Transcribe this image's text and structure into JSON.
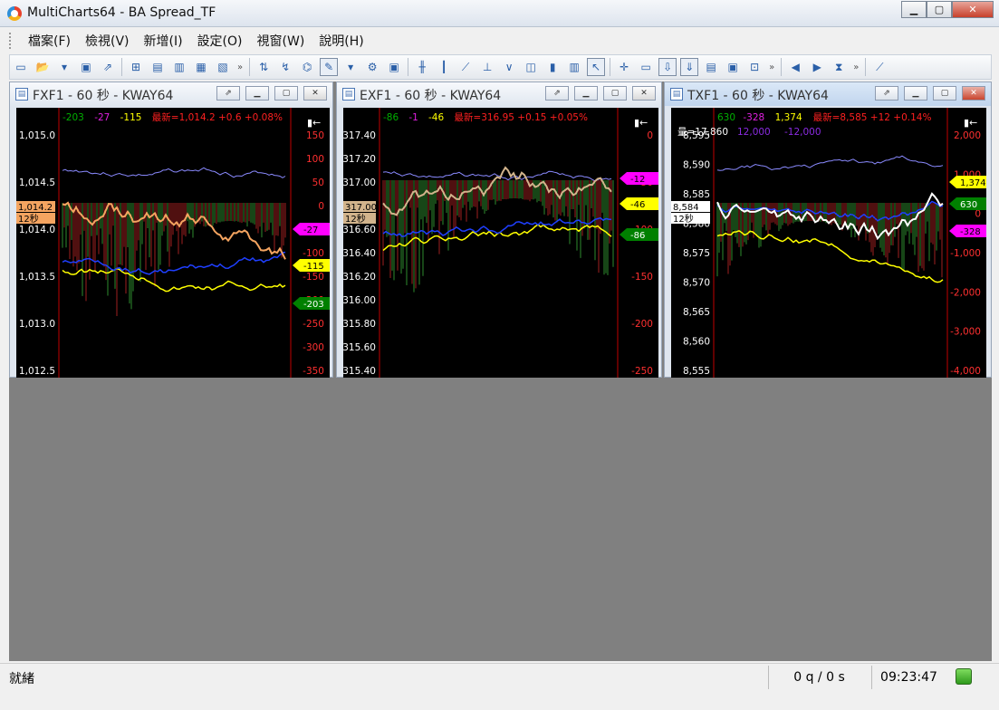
{
  "window": {
    "title": "MultiCharts64 - BA Spread_TF"
  },
  "menu": [
    "檔案(F)",
    "檢視(V)",
    "新增(I)",
    "設定(O)",
    "視窗(W)",
    "說明(H)"
  ],
  "toolbar": {
    "icons": [
      "new-chart-icon",
      "open-icon",
      "dropdown-icon",
      "save-icon",
      "export-icon",
      "new-window-icon",
      "insert-study-icon",
      "format-icon",
      "quote-icon",
      "scanner-icon",
      "more-icon",
      "indicator-icon",
      "signal-icon",
      "strategy-icon",
      "draw-tool-icon",
      "dropdown-icon",
      "autotrade-icon",
      "data-window-icon",
      "bar-chart-icon",
      "candle-chart-icon",
      "line-chart-icon",
      "hlc-chart-icon",
      "point-figure-icon",
      "hollow-candle-icon",
      "volume-candle-icon",
      "rainbow-icon",
      "cursor-icon",
      "crosshair-icon",
      "drawing-icon",
      "trade-bar-icon",
      "trade-down-icon",
      "view-icon",
      "screenshot-icon",
      "zoom-icon",
      "more-icon",
      "rewind-icon",
      "forward-icon",
      "hourglass-icon",
      "more-icon",
      "trendline-icon"
    ]
  },
  "charts": [
    {
      "title": "FXF1 - 60 秒 - KWAY64",
      "legend": [
        {
          "text": "-203",
          "color": "#00b000"
        },
        {
          "text": "-27",
          "color": "#e020e0"
        },
        {
          "text": "-115",
          "color": "#ffff00"
        },
        {
          "text": "最新=1,014.2  +0.6  +0.08%",
          "color": "#ff2020"
        }
      ],
      "left_axis": [
        "1,015.0",
        "1,014.5",
        "1,014.0",
        "1,013.5",
        "1,013.0",
        "1,012.5"
      ],
      "left_markers": [
        {
          "text": "1,014.2",
          "bg": "#f4a460",
          "fg": "#000"
        },
        {
          "text": "12秒",
          "bg": "#f4a460",
          "fg": "#000"
        }
      ],
      "right_axis": [
        "150",
        "100",
        "50",
        "0",
        "-50",
        "-100",
        "-150",
        "-200",
        "-250",
        "-300",
        "-350"
      ],
      "right_markers": [
        {
          "text": "-27",
          "bg": "#ff00ff",
          "fg": "#000"
        },
        {
          "text": "-115",
          "bg": "#ffff00",
          "fg": "#000"
        },
        {
          "text": "-203",
          "bg": "#008000",
          "fg": "#fff"
        }
      ],
      "price_color": "#f4a460"
    },
    {
      "title": "EXF1 - 60 秒 - KWAY64",
      "legend": [
        {
          "text": "-86",
          "color": "#00b000"
        },
        {
          "text": "-1",
          "color": "#e020e0"
        },
        {
          "text": "-46",
          "color": "#ffff00"
        },
        {
          "text": "最新=316.95  +0.15  +0.05%",
          "color": "#ff2020"
        }
      ],
      "left_axis": [
        "317.40",
        "317.20",
        "317.00",
        "316.80",
        "316.60",
        "316.40",
        "316.20",
        "316.00",
        "315.80",
        "315.60",
        "315.40"
      ],
      "left_markers": [
        {
          "text": "317.00",
          "bg": "#d2b48c",
          "fg": "#000"
        },
        {
          "text": "12秒",
          "bg": "#d2b48c",
          "fg": "#000"
        }
      ],
      "right_axis": [
        "0",
        "-50",
        "-100",
        "-150",
        "-200",
        "-250"
      ],
      "right_markers": [
        {
          "text": "-12",
          "bg": "#ff00ff",
          "fg": "#000"
        },
        {
          "text": "-46",
          "bg": "#ffff00",
          "fg": "#000"
        },
        {
          "text": "-86",
          "bg": "#008000",
          "fg": "#fff"
        }
      ],
      "price_color": "#d2b48c"
    },
    {
      "title": "TXF1 - 60 秒 - KWAY64",
      "legend": [
        {
          "text": "630",
          "color": "#00b000"
        },
        {
          "text": "-328",
          "color": "#e020e0"
        },
        {
          "text": "1,374",
          "color": "#ffff00"
        },
        {
          "text": "最新=8,585  +12  +0.14%",
          "color": "#ff2020"
        }
      ],
      "legend2": [
        {
          "text": "量=17,860",
          "color": "#ffffff"
        },
        {
          "text": "12,000",
          "color": "#8a2be2"
        },
        {
          "text": "-12,000",
          "color": "#8a2be2"
        }
      ],
      "left_axis": [
        "8,595",
        "8,590",
        "8,585",
        "8,580",
        "8,575",
        "8,570",
        "8,565",
        "8,560",
        "8,555"
      ],
      "left_markers": [
        {
          "text": "8,584",
          "bg": "#ffffff",
          "fg": "#000"
        },
        {
          "text": "12秒",
          "bg": "#ffffff",
          "fg": "#000"
        }
      ],
      "right_axis": [
        "2,000",
        "1,000",
        "0",
        "-1,000",
        "-2,000",
        "-3,000",
        "-4,000"
      ],
      "right_markers": [
        {
          "text": "1,374",
          "bg": "#ffff00",
          "fg": "#000"
        },
        {
          "text": "630",
          "bg": "#008000",
          "fg": "#fff"
        },
        {
          "text": "-328",
          "bg": "#ff00ff",
          "fg": "#000"
        }
      ],
      "price_color": "#ffffff"
    }
  ],
  "status": {
    "left": "就緒",
    "orders": "0 q / 0 s",
    "time": "09:23:47"
  }
}
